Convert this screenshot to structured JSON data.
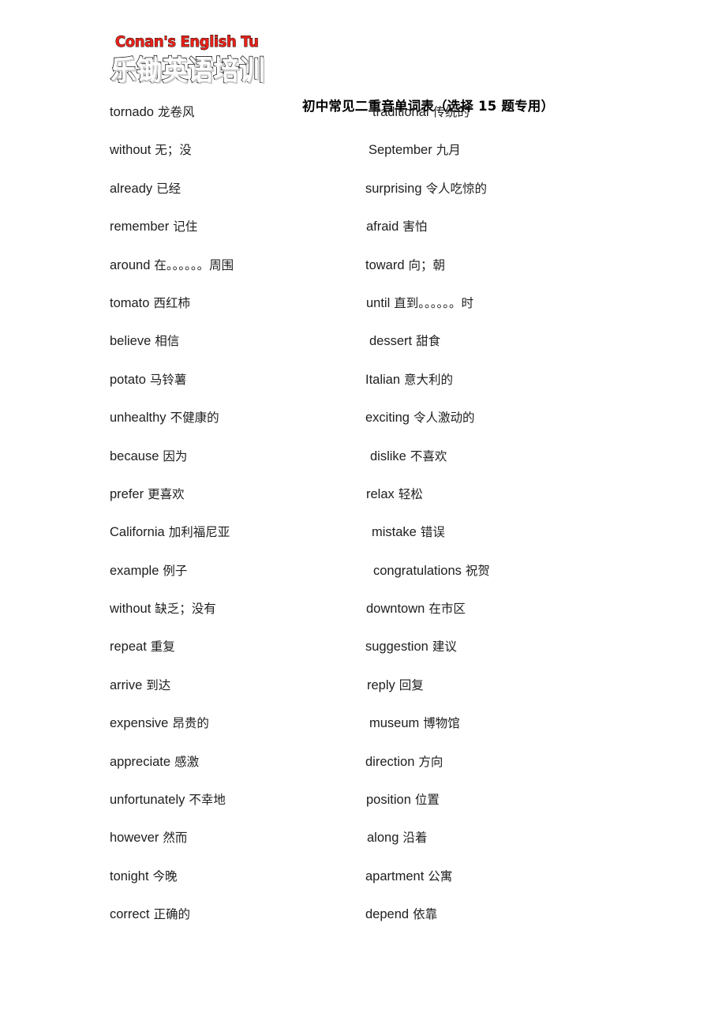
{
  "document": {
    "title": "初中常见二重音单词表（选择 15 题专用）"
  },
  "logo": {
    "english": "Conan's English Tu",
    "chinese": "乐锄英语培训",
    "color_red": "#e8221a",
    "color_outline": "#1b1b1b"
  },
  "word_list": {
    "left_column": [
      {
        "en": "tornado",
        "cn": "龙卷风"
      },
      {
        "en": "without",
        "cn": "无；没"
      },
      {
        "en": "already",
        "cn": "已经"
      },
      {
        "en": "remember",
        "cn": "记住"
      },
      {
        "en": "around",
        "cn": "在。。。。。。周围"
      },
      {
        "en": "tomato",
        "cn": "西红柿"
      },
      {
        "en": "believe",
        "cn": "相信"
      },
      {
        "en": "potato",
        "cn": "马铃薯"
      },
      {
        "en": "unhealthy",
        "cn": "不健康的"
      },
      {
        "en": "because",
        "cn": "因为"
      },
      {
        "en": "prefer",
        "cn": "更喜欢"
      },
      {
        "en": "California",
        "cn": "加利福尼亚"
      },
      {
        "en": "example",
        "cn": "例子"
      },
      {
        "en": "without",
        "cn": "缺乏；没有"
      },
      {
        "en": "repeat",
        "cn": "重复"
      },
      {
        "en": "arrive",
        "cn": "到达"
      },
      {
        "en": "expensive",
        "cn": "昂贵的"
      },
      {
        "en": "appreciate",
        "cn": "感激"
      },
      {
        "en": "unfortunately",
        "cn": "不幸地"
      },
      {
        "en": "however",
        "cn": "然而"
      },
      {
        "en": "tonight",
        "cn": "今晚"
      },
      {
        "en": "correct",
        "cn": "正确的"
      }
    ],
    "right_column": [
      {
        "en": "traditional",
        "cn": "传统的"
      },
      {
        "en": "September",
        "cn": "九月"
      },
      {
        "en": "surprising",
        "cn": "令人吃惊的"
      },
      {
        "en": "afraid",
        "cn": "害怕"
      },
      {
        "en": "toward",
        "cn": "向；朝"
      },
      {
        "en": "until",
        "cn": "直到。。。。。。时"
      },
      {
        "en": "dessert",
        "cn": "甜食"
      },
      {
        "en": "Italian",
        "cn": "意大利的"
      },
      {
        "en": "exciting",
        "cn": "令人激动的"
      },
      {
        "en": "dislike",
        "cn": "不喜欢"
      },
      {
        "en": "relax",
        "cn": "轻松"
      },
      {
        "en": "mistake",
        "cn": "错误"
      },
      {
        "en": "congratulations",
        "cn": "祝贺"
      },
      {
        "en": "downtown",
        "cn": "在市区"
      },
      {
        "en": "suggestion",
        "cn": "建议"
      },
      {
        "en": "reply",
        "cn": "回复"
      },
      {
        "en": "museum",
        "cn": "博物馆"
      },
      {
        "en": "direction",
        "cn": "方向"
      },
      {
        "en": "position",
        "cn": "位置"
      },
      {
        "en": "along",
        "cn": "沿着"
      },
      {
        "en": "apartment",
        "cn": "公寓"
      },
      {
        "en": "depend",
        "cn": "依靠"
      }
    ]
  },
  "layout": {
    "left_indents": [
      0,
      0,
      0,
      0,
      0,
      0,
      0,
      0,
      0,
      0,
      0,
      0,
      0,
      0,
      0,
      0,
      0,
      0,
      0,
      0,
      0,
      0
    ],
    "right_indents": [
      9,
      4,
      0,
      1,
      0,
      1,
      5,
      -4,
      -1,
      6,
      1,
      8,
      10,
      1,
      0,
      2,
      5,
      0,
      1,
      2,
      0,
      0
    ]
  }
}
